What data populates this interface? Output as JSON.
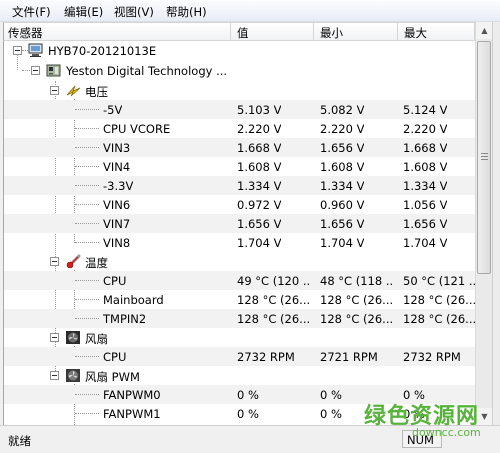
{
  "menu": [
    "文件(F)",
    "编辑(E)",
    "视图(V)",
    "帮助(H)"
  ],
  "columns": {
    "sensor": "传感器",
    "value": "值",
    "min": "最小",
    "max": "最大"
  },
  "tree": {
    "computer": "HYB70-20121013E",
    "board": "Yeston Digital Technology ...",
    "voltage": {
      "label": "电压",
      "rows": [
        {
          "name": "-5V",
          "value": "5.103 V",
          "min": "5.082 V",
          "max": "5.124 V"
        },
        {
          "name": "CPU VCORE",
          "value": "2.220 V",
          "min": "2.220 V",
          "max": "2.220 V"
        },
        {
          "name": "VIN3",
          "value": "1.668 V",
          "min": "1.656 V",
          "max": "1.668 V"
        },
        {
          "name": "VIN4",
          "value": "1.608 V",
          "min": "1.608 V",
          "max": "1.608 V"
        },
        {
          "name": "-3.3V",
          "value": "1.334 V",
          "min": "1.334 V",
          "max": "1.334 V"
        },
        {
          "name": "VIN6",
          "value": "0.972 V",
          "min": "0.960 V",
          "max": "1.056 V"
        },
        {
          "name": "VIN7",
          "value": "1.656 V",
          "min": "1.656 V",
          "max": "1.656 V"
        },
        {
          "name": "VIN8",
          "value": "1.704 V",
          "min": "1.704 V",
          "max": "1.704 V"
        }
      ]
    },
    "temperature": {
      "label": "温度",
      "rows": [
        {
          "name": "CPU",
          "value": "49 °C  (120 ...",
          "min": "48 °C  (118 ...",
          "max": "50 °C  (121 ..."
        },
        {
          "name": "Mainboard",
          "value": "128 °C  (26...",
          "min": "128 °C  (26...",
          "max": "128 °C  (26..."
        },
        {
          "name": "TMPIN2",
          "value": "128 °C  (26...",
          "min": "128 °C  (26...",
          "max": "128 °C  (26..."
        }
      ]
    },
    "fan": {
      "label": "风扇",
      "rows": [
        {
          "name": "CPU",
          "value": "2732 RPM",
          "min": "2721 RPM",
          "max": "2732 RPM"
        }
      ]
    },
    "fan_pwm": {
      "label": "风扇 PWM",
      "rows": [
        {
          "name": "FANPWM0",
          "value": "0 %",
          "min": "0 %",
          "max": "0 %"
        },
        {
          "name": "FANPWM1",
          "value": "0 %",
          "min": "0 %",
          "max": "0 %"
        }
      ]
    }
  },
  "status": {
    "text": "就绪",
    "num": "NUM"
  },
  "watermark": {
    "text": "绿色资源网",
    "url": "downcc.com"
  }
}
